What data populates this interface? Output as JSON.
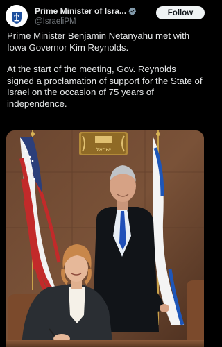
{
  "post": {
    "author": {
      "display_name": "Prime Minister of Isra...",
      "handle": "@IsraeliPM",
      "verified": true,
      "verified_badge_color": "#829aab",
      "avatar_icon": "state-emblem-icon"
    },
    "follow_label": "Follow",
    "paragraphs": [
      "Prime Minister Benjamin Netanyahu met with Iowa Governor Kim Reynolds.",
      "At the start of the meeting, Gov. Reynolds signed a proclamation of support for the State of Israel on the occasion of 75 years of independence."
    ],
    "media": {
      "emblem_text": "ישראל",
      "flags": [
        "us-flag",
        "israel-flag"
      ]
    }
  },
  "colors": {
    "background": "#000000",
    "text": "#e7e9ea",
    "secondary_text": "#71767b",
    "follow_button_bg": "#eff3f4"
  }
}
